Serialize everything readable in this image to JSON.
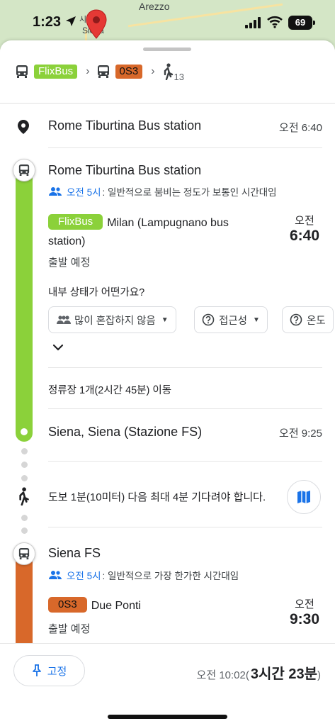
{
  "status_bar": {
    "time": "1:23",
    "battery": "69"
  },
  "map": {
    "town_large": "Arezzo",
    "town_small": "시",
    "town_label": "Siena"
  },
  "summary": {
    "leg1": "FlixBus",
    "leg2": "0S3",
    "walk_minutes": "13"
  },
  "origin": {
    "name": "Rome Tiburtina Bus station",
    "time": "오전 6:40"
  },
  "leg1": {
    "stop": "Rome Tiburtina Bus station",
    "crowd_time": "오전 5시",
    "crowd_text": ": 일반적으로 붐비는 정도가 보통인 시간대임",
    "line": "FlixBus",
    "destination": "Milan (Lampugnano bus station)",
    "schedule": "출발 예정",
    "dep_ampm": "오전",
    "dep_time": "6:40",
    "question": "내부 상태가 어떤가요?",
    "chips": [
      "많이 혼잡하지 않음",
      "접근성",
      "온도"
    ],
    "stops_summary": "정류장 1개(2시간 45분) 이동"
  },
  "arrival1": {
    "name": "Siena, Siena (Stazione FS)",
    "time": "오전 9:25"
  },
  "walk": {
    "text": "도보 1분(10미터) 다음 최대 4분 기다려야 합니다."
  },
  "leg2": {
    "stop": "Siena FS",
    "crowd_time": "오전 5시",
    "crowd_text": ": 일반적으로 가장 한가한 시간대임",
    "line": "0S3",
    "destination": "Due Ponti",
    "schedule": "출발 예정",
    "dep_ampm": "오전",
    "dep_time": "9:30"
  },
  "bottom": {
    "pin_label": "고정",
    "arrival": "오전 10:02(",
    "duration": "3시간 23분",
    "close": ")"
  },
  "colors": {
    "flixbus": "#8bd13a",
    "os3": "#d8682a",
    "accent": "#1a73e8"
  }
}
